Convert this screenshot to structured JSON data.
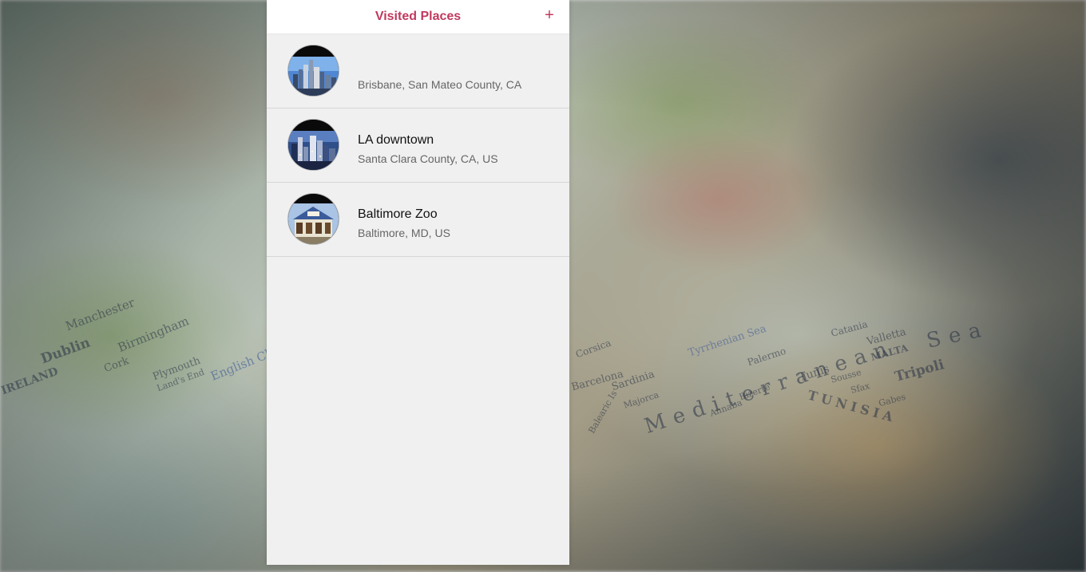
{
  "navbar": {
    "title": "Visited Places",
    "add_label": "+"
  },
  "places": [
    {
      "name": "",
      "location": "Brisbane, San Mateo County, CA",
      "thumbnail_icon": "city-skyline-photo"
    },
    {
      "name": "LA downtown",
      "location": "Santa Clara County, CA, US",
      "thumbnail_icon": "downtown-night-photo"
    },
    {
      "name": "Baltimore Zoo",
      "location": "Baltimore, MD, US",
      "thumbnail_icon": "zoo-building-photo"
    }
  ],
  "background": {
    "map_labels": [
      "Mediterranean",
      "Sea",
      "TUNISIA",
      "Tripoli",
      "Dublin",
      "Manchester",
      "Birmingham",
      "IRELAND",
      "Cork",
      "Plymouth",
      "English Channel",
      "Sardinia",
      "Corsica",
      "Palermo",
      "Tunis",
      "MALTA",
      "Valletta",
      "Tyrrhenian Sea",
      "Land's End",
      "Majorca",
      "Balearic Is",
      "Barcelona",
      "Annaba",
      "Bizerte",
      "Sousse",
      "Gabes",
      "Sfax",
      "Catania"
    ]
  },
  "colors": {
    "accent": "#c0395e",
    "panel_bg": "#f0f0f0",
    "navbar_bg": "#ffffff"
  }
}
